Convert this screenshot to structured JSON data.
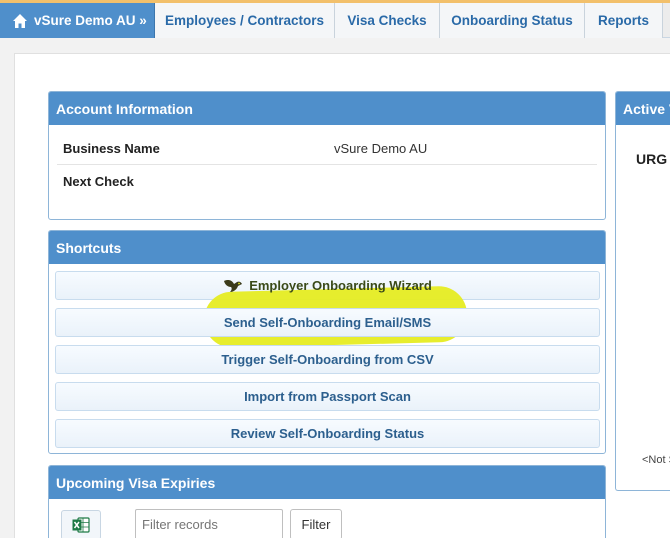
{
  "nav": {
    "home": "vSure Demo AU »",
    "employees": "Employees / Contractors",
    "visa_checks": "Visa Checks",
    "onboarding_status": "Onboarding Status",
    "reports": "Reports"
  },
  "account": {
    "title": "Account Information",
    "rows": [
      {
        "label": "Business Name",
        "value": "vSure Demo AU"
      },
      {
        "label": "Next Check",
        "value": ""
      }
    ]
  },
  "shortcuts": {
    "title": "Shortcuts",
    "items": [
      "Employer Onboarding Wizard",
      "Send Self-Onboarding Email/SMS",
      "Trigger Self-Onboarding from CSV",
      "Import from Passport Scan",
      "Review Self-Onboarding Status"
    ]
  },
  "expiries": {
    "title": "Upcoming Visa Expiries",
    "filter_placeholder": "Filter records",
    "filter_button": "Filter"
  },
  "active_panel": {
    "title": "Active V",
    "urgent": "URG",
    "not_set": "<Not S"
  },
  "colors": {
    "accent": "#4f8fcb",
    "highlight": "#e6ec22",
    "link": "#2a6aa8"
  }
}
